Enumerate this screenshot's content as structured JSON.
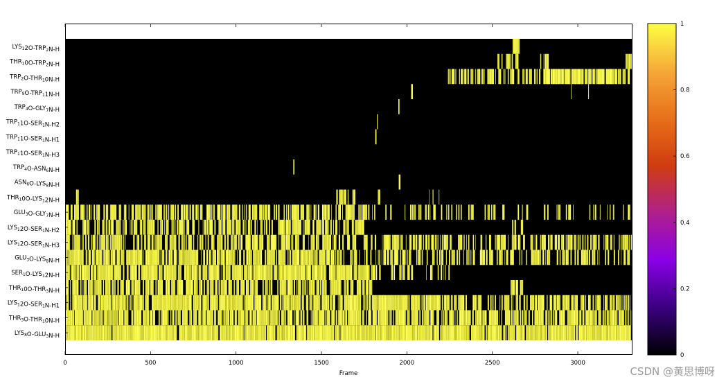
{
  "chart_data": {
    "type": "heatmap",
    "title": "",
    "xlabel": "Frame",
    "ylabel": "",
    "xlim": [
      0,
      3320
    ],
    "x_ticks": [
      0,
      500,
      1000,
      1500,
      2000,
      2500,
      3000
    ],
    "colorbar": {
      "range": [
        0,
        1
      ],
      "ticks": [
        0,
        0.2,
        0.4,
        0.6,
        0.8,
        1
      ],
      "tick_labels": [
        "0",
        "0.2",
        "0.4",
        "0.6",
        "0.8",
        "1"
      ],
      "colors": [
        "#000000",
        "#3a0080",
        "#8a00e6",
        "#b0208a",
        "#d03c10",
        "#e8701a",
        "#f5a838",
        "#ffff44"
      ]
    },
    "rows": [
      {
        "label": "LYS12O-TRP2N-H",
        "base": "LYS",
        "sub1": "1",
        "mid": "2O-TRP",
        "sub2": "2",
        "tail": "N-H",
        "segments": [
          [
            2615,
            2660,
            0.9
          ]
        ]
      },
      {
        "label": "THR10O-TRP2N-H",
        "base": "THR",
        "sub1": "1",
        "mid": "0O-TRP",
        "sub2": "2",
        "tail": "N-H",
        "segments": [
          [
            2530,
            2560,
            0.5
          ],
          [
            2580,
            2620,
            0.6
          ],
          [
            2635,
            2660,
            0.7
          ],
          [
            2780,
            2830,
            0.5
          ],
          [
            3280,
            3320,
            0.9
          ]
        ]
      },
      {
        "label": "TRP2O-THR10N-H",
        "base": "TRP",
        "sub1": "2",
        "mid": "O-THR",
        "sub2": "1",
        "tail": "0N-H",
        "segments": [
          [
            2240,
            3320,
            0.55
          ],
          [
            2800,
            3250,
            0.7
          ]
        ]
      },
      {
        "label": "TRP9O-TRP11N-H",
        "base": "TRP",
        "sub1": "9",
        "mid": "O-TRP",
        "sub2": "1",
        "tail": "1N-H",
        "segments": [
          [
            2025,
            2035,
            0.6
          ],
          [
            2960,
            2970,
            0.4
          ],
          [
            3055,
            3065,
            0.4
          ]
        ]
      },
      {
        "label": "TRP4O-GLY7N-H",
        "base": "TRP",
        "sub1": "4",
        "mid": "O-GLY",
        "sub2": "7",
        "tail": "N-H",
        "segments": [
          [
            1950,
            1960,
            0.7
          ]
        ]
      },
      {
        "label": "TRP11O-SER1N-H2",
        "base": "TRP",
        "sub1": "1",
        "mid": "1O-SER",
        "sub2": "1",
        "tail": "N-H2",
        "segments": [
          [
            1825,
            1830,
            0.7
          ]
        ]
      },
      {
        "label": "TRP11O-SER1N-H1",
        "base": "TRP",
        "sub1": "1",
        "mid": "1O-SER",
        "sub2": "1",
        "tail": "N-H1",
        "segments": [
          [
            1815,
            1822,
            0.7
          ]
        ]
      },
      {
        "label": "TRP11O-SER1N-H3",
        "base": "TRP",
        "sub1": "1",
        "mid": "1O-SER",
        "sub2": "1",
        "tail": "N-H3",
        "segments": [
          [
            1675,
            1680,
            0.4
          ]
        ]
      },
      {
        "label": "TRP4O-ASN6N-H",
        "base": "TRP",
        "sub1": "4",
        "mid": "O-ASN",
        "sub2": "6",
        "tail": "N-H",
        "segments": [
          [
            1335,
            1342,
            0.7
          ]
        ]
      },
      {
        "label": "ASN6O-LYS8N-H",
        "base": "ASN",
        "sub1": "6",
        "mid": "O-LYS",
        "sub2": "8",
        "tail": "N-H",
        "segments": [
          [
            540,
            545,
            0.4
          ],
          [
            1130,
            1140,
            0.6
          ],
          [
            1945,
            1965,
            0.6
          ],
          [
            1985,
            1995,
            0.4
          ]
        ]
      },
      {
        "label": "THR10O-LYS12N-H",
        "base": "THR",
        "sub1": "1",
        "mid": "0O-LYS",
        "sub2": "1",
        "tail": "2N-H",
        "segments": [
          [
            60,
            80,
            0.4
          ],
          [
            1560,
            1700,
            0.55
          ],
          [
            1830,
            1850,
            0.5
          ],
          [
            2130,
            2190,
            0.6
          ]
        ]
      },
      {
        "label": "GLU3O-GLY7N-H",
        "base": "GLU",
        "sub1": "3",
        "mid": "O-GLY",
        "sub2": "7",
        "tail": "N-H",
        "segments": [
          [
            0,
            1800,
            0.55
          ],
          [
            1800,
            3320,
            0.28
          ]
        ]
      },
      {
        "label": "LYS12O-SER1N-H2",
        "base": "LYS",
        "sub1": "1",
        "mid": "2O-SER",
        "sub2": "1",
        "tail": "N-H2",
        "segments": [
          [
            0,
            1750,
            0.6
          ],
          [
            2600,
            2680,
            0.4
          ]
        ]
      },
      {
        "label": "LYS12O-SER1N-H3",
        "base": "LYS",
        "sub1": "1",
        "mid": "2O-SER",
        "sub2": "1",
        "tail": "N-H3",
        "segments": [
          [
            0,
            1780,
            0.55
          ],
          [
            1780,
            3320,
            0.45
          ]
        ]
      },
      {
        "label": "GLU3O-LYS8N-H",
        "base": "GLU",
        "sub1": "3",
        "mid": "O-LYS",
        "sub2": "8",
        "tail": "N-H",
        "segments": [
          [
            0,
            1600,
            0.8
          ],
          [
            1600,
            3320,
            0.5
          ]
        ]
      },
      {
        "label": "SER1O-LYS12N-H",
        "base": "SER",
        "sub1": "1",
        "mid": "O-LYS",
        "sub2": "1",
        "tail": "2N-H",
        "segments": [
          [
            0,
            1850,
            0.85
          ],
          [
            1900,
            2050,
            0.55
          ],
          [
            2100,
            2250,
            0.35
          ]
        ]
      },
      {
        "label": "THR10O-THR3N-H",
        "base": "THR",
        "sub1": "1",
        "mid": "0O-THR",
        "sub2": "3",
        "tail": "N-H",
        "segments": [
          [
            0,
            1800,
            0.7
          ],
          [
            2600,
            2680,
            0.4
          ]
        ]
      },
      {
        "label": "LYS12O-SER1N-H1",
        "base": "LYS",
        "sub1": "1",
        "mid": "2O-SER",
        "sub2": "1",
        "tail": "N-H1",
        "segments": [
          [
            0,
            2250,
            0.85
          ],
          [
            2250,
            3320,
            0.6
          ]
        ]
      },
      {
        "label": "THR3O-THR10N-H",
        "base": "THR",
        "sub1": "3",
        "mid": "O-THR",
        "sub2": "1",
        "tail": "0N-H",
        "segments": [
          [
            0,
            3320,
            0.8
          ]
        ]
      },
      {
        "label": "LYS8O-GLU3N-H",
        "base": "LYS",
        "sub1": "8",
        "mid": "O-GLU",
        "sub2": "3",
        "tail": "N-H",
        "segments": [
          [
            0,
            3320,
            0.95
          ]
        ]
      }
    ]
  },
  "watermark": "CSDN @黄思博呀"
}
